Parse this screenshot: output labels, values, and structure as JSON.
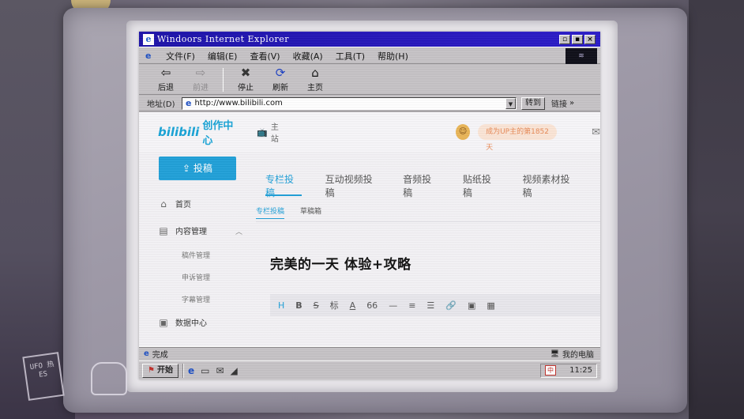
{
  "window": {
    "title": "Windoors Internet Explorer",
    "buttons": [
      "▫",
      "▪",
      "×"
    ]
  },
  "menu": {
    "items": [
      "文件(F)",
      "编辑(E)",
      "查看(V)",
      "收藏(A)",
      "工具(T)",
      "帮助(H)"
    ]
  },
  "toolbar": {
    "back": "后退",
    "forward": "前进",
    "stop": "停止",
    "refresh": "刷新",
    "home": "主页"
  },
  "address": {
    "label": "地址(D)",
    "url": "http://www.bilibili.com",
    "go": "转到",
    "links": "链接",
    "more": "»"
  },
  "page": {
    "logo": "bilibili",
    "creator_title": "创作中心",
    "home_link": "主站",
    "up_badge": "成为UP主的第1852天",
    "upload_button": "投稿",
    "sidebar": {
      "home": "首页",
      "content_manage": "内容管理",
      "sub_items": [
        "稿件管理",
        "申诉管理",
        "字幕管理"
      ],
      "data_center": "数据中心"
    },
    "tabs": [
      "专栏投稿",
      "互动视频投稿",
      "音频投稿",
      "贴纸投稿",
      "视频素材投稿"
    ],
    "subtabs": [
      "专栏投稿",
      "草稿箱"
    ],
    "article_title": "完美的一天 体验+攻略",
    "editor_tools": [
      "H",
      "B",
      "S",
      "标",
      "A",
      "66",
      "—",
      "≡",
      "☰",
      "🔗",
      "▣",
      "▦"
    ]
  },
  "status": {
    "text": "完成",
    "zone": "我的电脑"
  },
  "taskbar": {
    "start": "开始",
    "clock": "11:25",
    "ime": "中"
  },
  "decor": {
    "stamp": "UFO 热 ES"
  },
  "colors": {
    "titlebar": "#1c12a8",
    "bili_blue": "#20a0d8",
    "badge": "#e88a57"
  }
}
